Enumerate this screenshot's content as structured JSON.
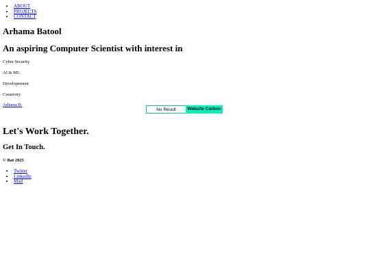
{
  "nav": {
    "items": [
      "ABOUT",
      "PROJECTS",
      "CONTACT"
    ]
  },
  "hero": {
    "name": "Arhama Batool",
    "headline": "An aspiring Computer Scientist with interest in",
    "interests": [
      "Cyber Security",
      "AI & ML",
      "Developement",
      "Creativity"
    ],
    "author_link": "Arhama B."
  },
  "badge": {
    "result_text": "No Result",
    "link_text": "Website Carbon",
    "colors": {
      "border": "#00c8a0",
      "fill": "#00f0c0"
    }
  },
  "contact": {
    "heading": "Let's Work Together.",
    "subheading": "Get In Touch."
  },
  "footer": {
    "copyright": "© Bat 2025",
    "links": [
      "Twitter",
      "LinkedIn",
      "Mail"
    ]
  }
}
